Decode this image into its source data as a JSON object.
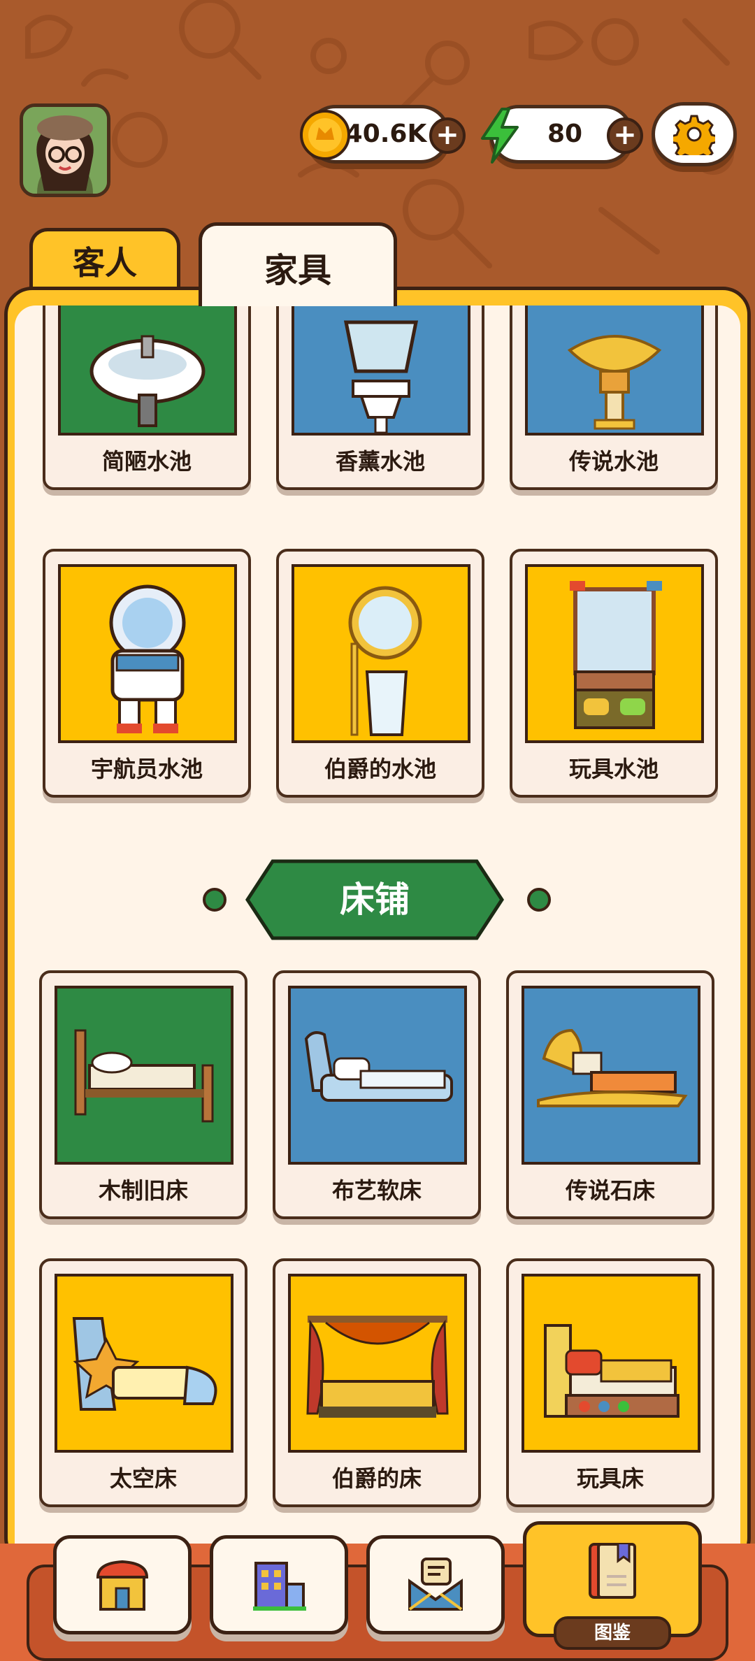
{
  "header": {
    "coins": "40.6K",
    "energy": "80"
  },
  "tabs": [
    {
      "label": "客人"
    },
    {
      "label": "家具"
    }
  ],
  "grid_top": [
    {
      "label": "简陋水池"
    },
    {
      "label": "香薰水池"
    },
    {
      "label": "传说水池"
    },
    {
      "label": "宇航员水池"
    },
    {
      "label": "伯爵的水池"
    },
    {
      "label": "玩具水池"
    }
  ],
  "section": {
    "title": "床铺"
  },
  "grid_beds": [
    {
      "label": "木制旧床"
    },
    {
      "label": "布艺软床"
    },
    {
      "label": "传说石床"
    },
    {
      "label": "太空床"
    },
    {
      "label": "伯爵的床"
    },
    {
      "label": "玩具床"
    }
  ],
  "bottom_nav": {
    "active_label": "图鉴"
  },
  "colors": {
    "background": "#a95a2c",
    "accent_yellow": "#ffc328",
    "card_green": "#2e8a44",
    "card_blue": "#4a8ec0",
    "card_yellow": "#ffc100"
  }
}
